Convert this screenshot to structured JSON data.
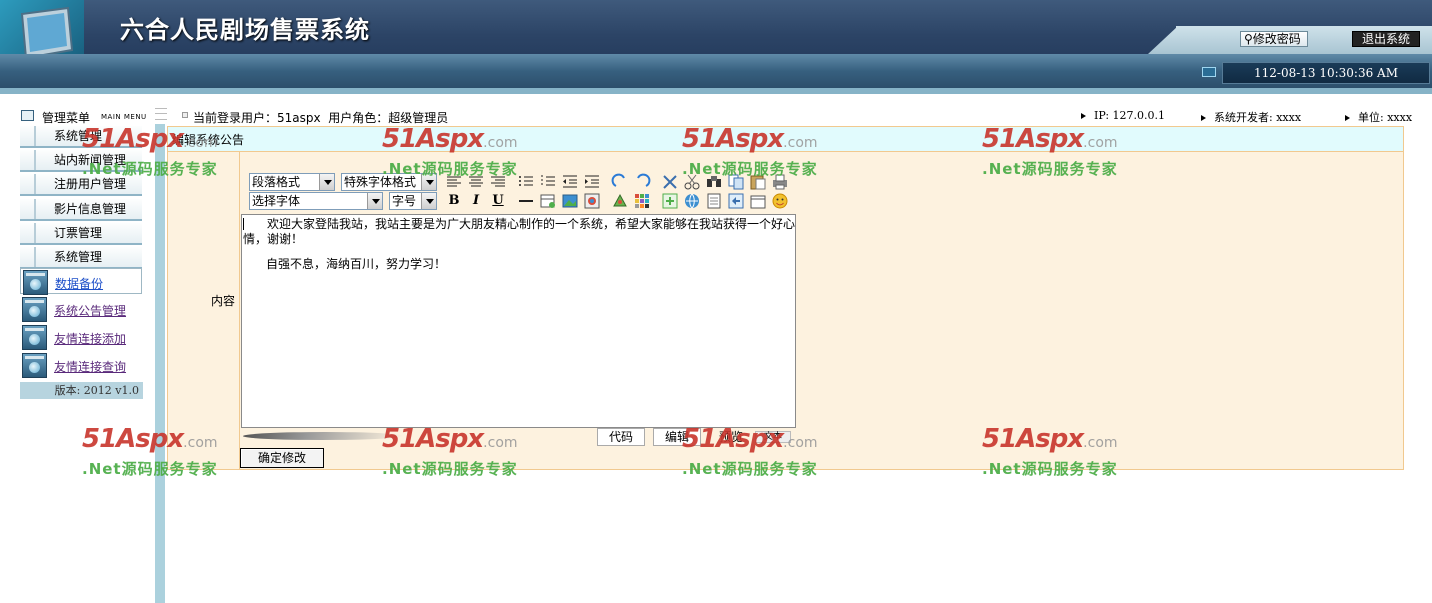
{
  "header": {
    "title": "六合人民剧场售票系统",
    "change_password": "修改密码",
    "logout": "退出系统",
    "datetime": "112-08-13 10:30:36 AM"
  },
  "infobar": {
    "menu_title": "管理菜单",
    "menu_subtitle": "MAIN MENU",
    "current_user_label": "当前登录用户：",
    "current_user": "51aspx",
    "role_label": "用户角色：",
    "role": "超级管理员",
    "ip": "IP: 127.0.0.1",
    "developer": "系统开发者: xxxx",
    "unit": "单位: xxxx"
  },
  "sidebar": {
    "items": [
      {
        "label": "系统管理"
      },
      {
        "label": "站内新闻管理"
      },
      {
        "label": "注册用户管理"
      },
      {
        "label": "影片信息管理"
      },
      {
        "label": "订票管理"
      },
      {
        "label": "系统管理"
      }
    ],
    "subitems": [
      {
        "label": "数据备份"
      },
      {
        "label": "系统公告管理"
      },
      {
        "label": "友情连接添加"
      },
      {
        "label": "友情连接查询"
      }
    ],
    "version": "版本: 2012 v1.0"
  },
  "main": {
    "panel_title": "编辑系统公告",
    "content_label": "内容",
    "submit_label": "确定修改"
  },
  "editor": {
    "paragraph_format": "段落格式",
    "special_format": "特殊字体格式",
    "font": "选择字体",
    "font_size": "字号",
    "bold": "B",
    "italic": "I",
    "underline": "U",
    "content_p1": "欢迎大家登陆我站，我站主要是为广大朋友精心制作的一个系统，希望大家能够在我站获得一个好心情，谢谢！",
    "content_p2": "自强不息，海纳百川，努力学习！",
    "mode_code": "代码",
    "mode_edit": "编辑",
    "mode_preview": "预览",
    "mode_text": "文本"
  },
  "watermark": {
    "logo": "51Aspx",
    "domain": ".com",
    "slogan": ".Net源码服务专家"
  }
}
